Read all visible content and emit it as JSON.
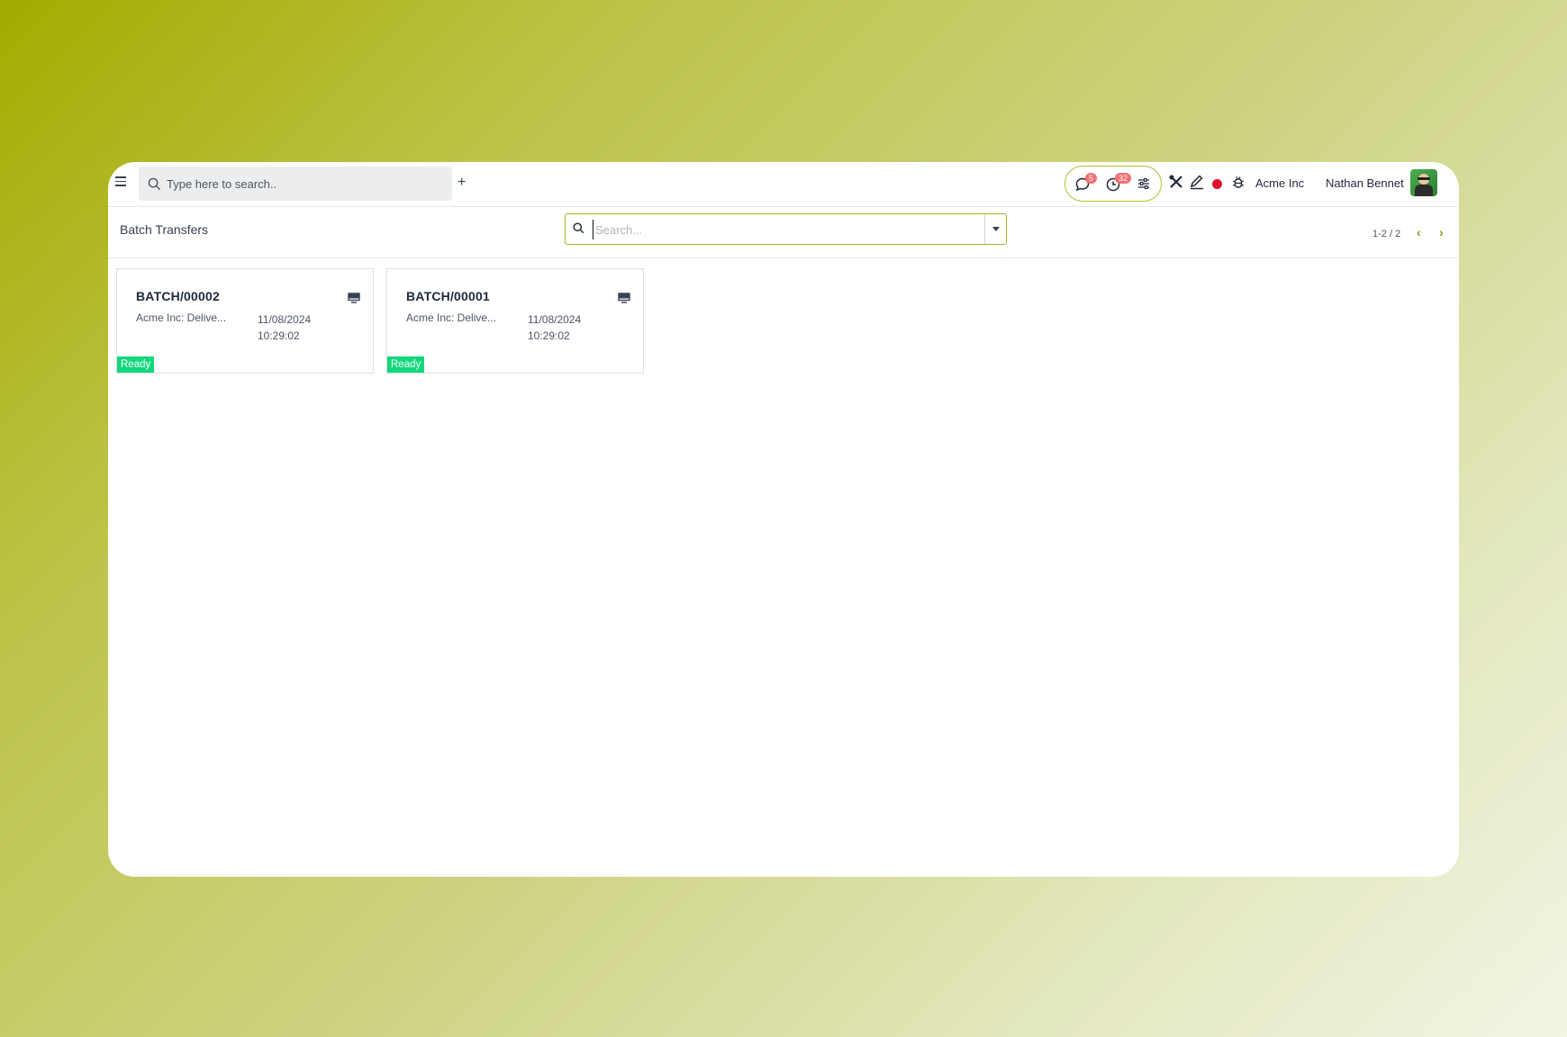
{
  "topbar": {
    "search_placeholder": "Type here to search..",
    "add_label": "+",
    "messages_count": "5",
    "activities_count": "32",
    "company": "Acme Inc",
    "user": "Nathan Bennet",
    "status_dot_color": "#e0102e"
  },
  "controlbar": {
    "title": "Batch Transfers",
    "search_placeholder": "Search...",
    "pager_count": "1-2 / 2",
    "prev_label": "‹",
    "next_label": "›"
  },
  "cards": [
    {
      "name": "BATCH/00002",
      "description": "Acme Inc: Delive...",
      "date": "11/08/2024",
      "time": "10:29:02",
      "status": "Ready"
    },
    {
      "name": "BATCH/00001",
      "description": "Acme Inc: Delive...",
      "date": "11/08/2024",
      "time": "10:29:02",
      "status": "Ready"
    }
  ],
  "colors": {
    "accent": "#a9b32a",
    "status_ready": "#10d87a",
    "badge": "#f26f73"
  }
}
